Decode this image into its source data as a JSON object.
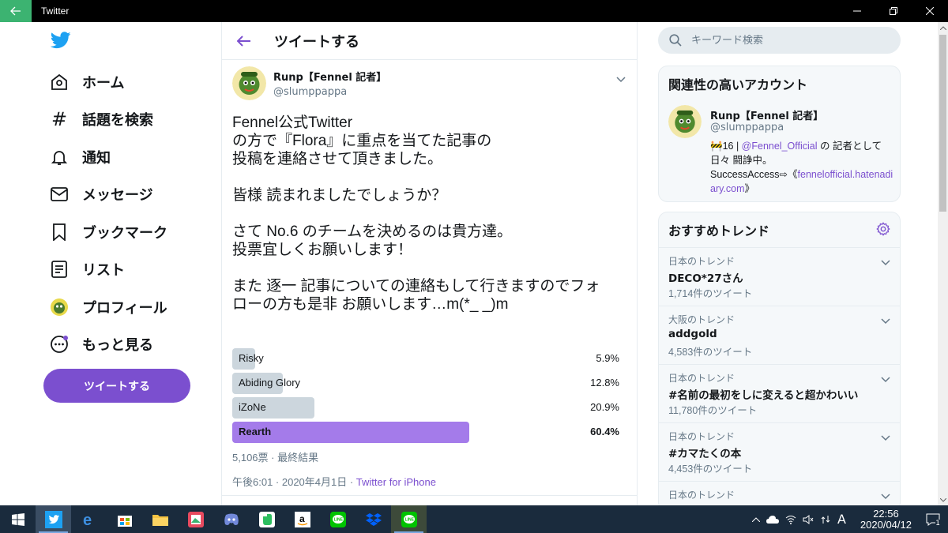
{
  "window": {
    "title": "Twitter"
  },
  "nav": {
    "items": [
      {
        "label": "ホーム",
        "icon": "home-icon"
      },
      {
        "label": "話題を検索",
        "icon": "hashtag-icon"
      },
      {
        "label": "通知",
        "icon": "bell-icon"
      },
      {
        "label": "メッセージ",
        "icon": "mail-icon"
      },
      {
        "label": "ブックマーク",
        "icon": "bookmark-icon"
      },
      {
        "label": "リスト",
        "icon": "list-icon"
      },
      {
        "label": "プロフィール",
        "icon": "profile-avatar-icon"
      },
      {
        "label": "もっと見る",
        "icon": "more-dots-icon"
      }
    ],
    "tweet_button": "ツイートする"
  },
  "header": {
    "title": "ツイートする"
  },
  "tweet": {
    "author_name": "Runp【Fennel 記者】",
    "author_handle": "@slumppappa",
    "text": "Fennel公式Twitter\nの方で『Flora』に重点を当てた記事の\n投稿を連絡させて頂きました。\n\n皆様 読まれましたでしょうか？\n\nさて No.6 のチームを決めるのは貴方達。\n投票宜しくお願いします！\n\nまた 逐一 記事についての連絡もして行きますのでフォ\nローの方も是非 お願いします…m(*_ _)m",
    "poll": [
      {
        "label": "Risky",
        "percent_text": "5.9%",
        "value": 5.9,
        "winner": false
      },
      {
        "label": "Abiding Glory",
        "percent_text": "12.8%",
        "value": 12.8,
        "winner": false
      },
      {
        "label": "iZoNe",
        "percent_text": "20.9%",
        "value": 20.9,
        "winner": false
      },
      {
        "label": "Rearth",
        "percent_text": "60.4%",
        "value": 60.4,
        "winner": true
      }
    ],
    "poll_meta": "5,106票 · 最終結果",
    "timestamp": "午後6:01 · 2020年4月1日 · ",
    "source": "Twitter for iPhone"
  },
  "search": {
    "placeholder": "キーワード検索"
  },
  "related": {
    "title": "関連性の高いアカウント",
    "name": "Runp【Fennel 記者】",
    "handle": "@slumppappa",
    "bio_prefix": "🚧16 | ",
    "bio_mention": "@Fennel_Official",
    "bio_middle": " の 記者として 日々 闘諍中。",
    "bio_line2": "SuccessAccess⇨《",
    "bio_link": "fennelofficial.hatenadiary.com",
    "bio_end": "》"
  },
  "trends": {
    "title": "おすすめトレンド",
    "items": [
      {
        "context": "日本のトレンド",
        "name": "DECO*27さん",
        "count": "1,714件のツイート"
      },
      {
        "context": "大阪のトレンド",
        "name": "addgold",
        "count": "4,583件のツイート"
      },
      {
        "context": "日本のトレンド",
        "name": "#名前の最初をしに変えると超かわいい",
        "count": "11,780件のツイート"
      },
      {
        "context": "日本のトレンド",
        "name": "#カマたくの本",
        "count": "4,453件のツイート"
      },
      {
        "context": "日本のトレンド",
        "name": "",
        "count": ""
      }
    ]
  },
  "taskbar": {
    "clock_time": "22:56",
    "clock_date": "2020/04/12",
    "ime": "A",
    "notifications": "1"
  },
  "colors": {
    "accent": "#7b4fcf",
    "poll_winner": "#a47bea",
    "poll_bar": "#ccd6dd",
    "twitter_blue": "#1da1f2"
  }
}
